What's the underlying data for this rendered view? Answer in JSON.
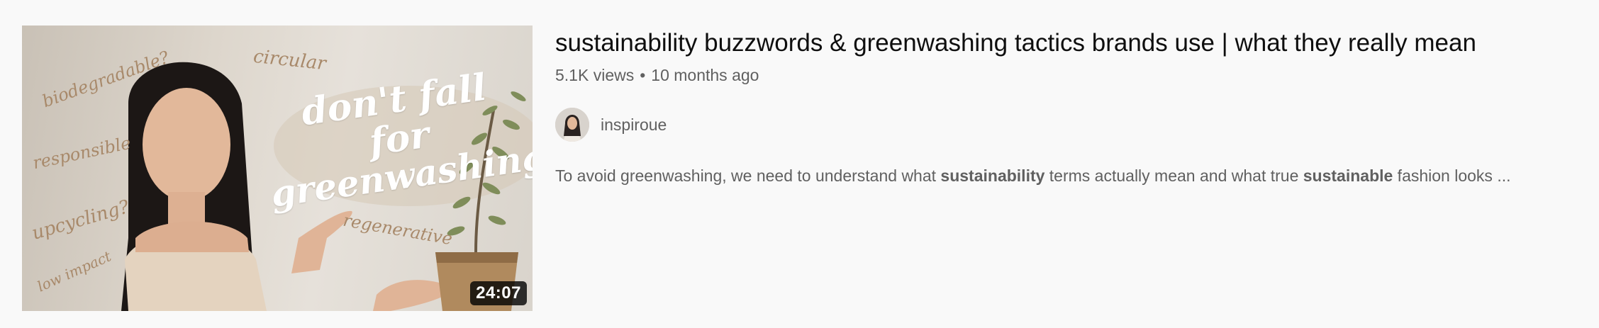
{
  "video": {
    "title": "sustainability buzzwords & greenwashing tactics brands use | what they really mean",
    "views": "5.1K views",
    "separator": "•",
    "age": "10 months ago",
    "duration": "24:07",
    "channel": {
      "name": "inspiroue"
    },
    "description": {
      "p1": "To avoid greenwashing, we need to understand what ",
      "b1": "sustainability",
      "p2": " terms actually mean and what true ",
      "b2": "sustainable",
      "p3": " fashion looks ..."
    }
  },
  "thumbnail": {
    "words": {
      "biodegradable": "biodegradable?",
      "circular": "circular",
      "responsible": "responsible",
      "upcycling": "upcycling?",
      "low_impact": "low impact",
      "regenerative": "regenerative"
    },
    "overlay_line1": "don't fall for",
    "overlay_line2": "greenwashing"
  },
  "colors": {
    "background": "#f9f9f9",
    "title": "#0f0f0f",
    "secondary_text": "#606060",
    "duration_badge": "#000000",
    "thumbnail_word": "#a8896a"
  }
}
